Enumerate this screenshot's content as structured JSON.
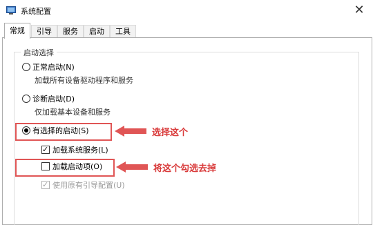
{
  "window": {
    "title": "系统配置",
    "close_label": "✕"
  },
  "tabs": [
    {
      "label": "常规",
      "active": true
    },
    {
      "label": "引导",
      "active": false
    },
    {
      "label": "服务",
      "active": false
    },
    {
      "label": "启动",
      "active": false
    },
    {
      "label": "工具",
      "active": false
    }
  ],
  "startup_group": {
    "legend": "启动选择",
    "normal": {
      "label": "正常启动(N)",
      "desc": "加载所有设备驱动程序和服务",
      "selected": false
    },
    "diagnostic": {
      "label": "诊断启动(D)",
      "desc": "仅加载基本设备和服务",
      "selected": false
    },
    "selective": {
      "label": "有选择的启动(S)",
      "selected": true,
      "options": {
        "load_system_services": {
          "label": "加载系统服务(L)",
          "checked": true,
          "enabled": true
        },
        "load_startup_items": {
          "label": "加载启动项(O)",
          "checked": false,
          "enabled": true
        },
        "use_original_boot": {
          "label": "使用原有引导配置(U)",
          "checked": true,
          "enabled": false
        }
      }
    }
  },
  "annotations": {
    "select_this": "选择这个",
    "uncheck_this": "将这个勾选去掉",
    "color": "#d93b3b"
  }
}
